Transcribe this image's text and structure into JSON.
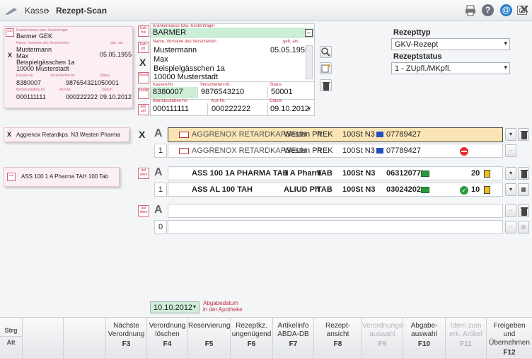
{
  "titlebar": {
    "home": "Kasse",
    "sep": "›",
    "title": "Rezept-Scan"
  },
  "scan1": {
    "kasse": "Barmer GEK",
    "name": "Mustermann",
    "vorname": "Max",
    "geb": "05.05.1955",
    "strasse": "Beispielgässchen 1a",
    "ort": "10000 Musterstadt",
    "kassennr": "8380007",
    "versnr": "9876543210",
    "status": "50001",
    "bsnr": "000111111",
    "arztnr": "000222222",
    "datum": "09.10.2012",
    "lbl_kasse": "Krankenkasse bzw. Kostenträger",
    "lbl_name": "Name, Vorname des Versicherten",
    "lbl_geb": "geb. am",
    "lbl_kassennr": "Kassen-Nr.",
    "lbl_versnr": "Versicherten-Nr.",
    "lbl_status": "Status",
    "lbl_bsnr": "Betriebsstätten-Nr.",
    "lbl_arztnr": "Arzt-Nr.",
    "lbl_datum": "Datum",
    "mark": "X"
  },
  "form": {
    "kasse": "BARMER",
    "lbl_kasse": "Krankenkasse bzw. Kostenträger",
    "lbl_name": "Name, Vorname des Versicherten",
    "lbl_geb": "geb. am",
    "name": "Mustermann",
    "vorname": "Max",
    "geb": "05.05.1955",
    "strasse": "Beispielgässchen 1a",
    "ort": "10000 Musterstadt",
    "lbl_kassennr": "Kassen-Nr.",
    "lbl_versnr": "Versicherten-Nr.",
    "lbl_status": "Status",
    "kassennr": "8380007",
    "versnr": "9876543210",
    "status": "50001",
    "lbl_bsnr": "Betriebsstätten-Nr.",
    "lbl_arztnr": "Arzt-Nr.",
    "lbl_datum": "Datum",
    "bsnr": "000111111",
    "arztnr": "000222222",
    "datum": "09.10.2012",
    "mark": "X"
  },
  "tags": {
    "gebfrei": "Geb.\nfrei",
    "gebpfl": "Geb.\npfl.",
    "noctu": "noctu",
    "sonst": "Sonst.",
    "unfall": "Unfall",
    "arbeit": "Arbeits-\nunfall",
    "autidem": "aut\nidem"
  },
  "rezept": {
    "typ_label": "Rezepttyp",
    "typ_value": "GKV-Rezept",
    "status_label": "Rezeptstatus",
    "status_value": "1 - ZUpfl./MKpfl."
  },
  "scan_items": [
    {
      "mark": "X",
      "text": "Aggrenox Retardkps. N3 Westen Pharma"
    },
    {
      "text": "ASS 100 1 A Pharma TAH 100 Tab"
    }
  ],
  "rows": {
    "r1a": {
      "mark": "X",
      "letter": "A",
      "name": "AGGRENOX RETARDKAPSELN",
      "hersteller": "Westen Ph",
      "form": "REK",
      "menge": "100St N3",
      "pzn": "07789427"
    },
    "r1b": {
      "qty": "1",
      "name": "AGGRENOX RETARDKAPSELN",
      "hersteller": "Westen Ph",
      "form": "REK",
      "menge": "100St N3",
      "pzn": "07789427"
    },
    "r2a": {
      "letter": "A",
      "name": "ASS 100 1A PHARMA TAH",
      "hersteller": "1 A Pharm",
      "form": "TAB",
      "menge": "100St N3",
      "pzn": "06312077",
      "stock": "20"
    },
    "r2b": {
      "qty": "1",
      "name": "ASS AL 100 TAH",
      "hersteller": "ALIUD Ph",
      "form": "TAB",
      "menge": "100St N3",
      "pzn": "03024202",
      "stock": "10"
    },
    "r3a": {
      "letter": "A"
    },
    "r3b": {
      "qty": "0"
    }
  },
  "abgabe": {
    "date": "10.10.2012",
    "label": "Abgabedatum\nin der Apotheke"
  },
  "footer": {
    "strg": "Strg",
    "alt": "Alt",
    "keys": [
      {
        "l1": "Nächste",
        "l2": "Verordnung",
        "k": "F3"
      },
      {
        "l1": "Verordnung",
        "l2": "löschen",
        "k": "F4"
      },
      {
        "l1": "Reservierung",
        "l2": "",
        "k": "F5"
      },
      {
        "l1": "Rezeptkz.",
        "l2": "ungenügend",
        "k": "F6"
      },
      {
        "l1": "Artikelinfo",
        "l2": "ABDA-DB",
        "k": "F7"
      },
      {
        "l1": "Rezept-",
        "l2": "ansicht",
        "k": "F8"
      },
      {
        "l1": "Verordnungs-",
        "l2": "auswahl",
        "k": "F9"
      },
      {
        "l1": "Abgabe-",
        "l2": "auswahl",
        "k": "F10"
      },
      {
        "l1": "Idem zum",
        "l2": "erk. Artikel",
        "k": "F11"
      },
      {
        "l1": "Freigeben und",
        "l2": "Übernehmen",
        "k": "F12"
      }
    ]
  },
  "colors": {
    "green": "#cdeed6",
    "highlight": "#fbe5b6",
    "accent_red": "#c03040"
  }
}
